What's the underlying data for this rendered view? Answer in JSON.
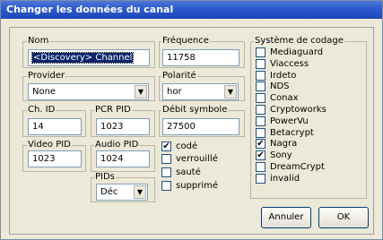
{
  "window": {
    "title": "Changer les données du canal"
  },
  "fields": {
    "nom": {
      "label": "Nom",
      "value": "<Discovery> Channel"
    },
    "frequence": {
      "label": "Fréquence",
      "value": "11758"
    },
    "provider": {
      "label": "Provider",
      "value": "None"
    },
    "polarite": {
      "label": "Polarité",
      "value": "hor"
    },
    "ch_id": {
      "label": "Ch. ID",
      "value": "14"
    },
    "pcr_pid": {
      "label": "PCR PID",
      "value": "1023"
    },
    "debit": {
      "label": "Débit symbole",
      "value": "27500"
    },
    "video_pid": {
      "label": "Video PID",
      "value": "1023"
    },
    "audio_pid": {
      "label": "Audio PID",
      "value": "1024"
    },
    "pids": {
      "label": "PIDs",
      "value": "Déc"
    }
  },
  "flags": [
    {
      "label": "codé",
      "checked": true
    },
    {
      "label": "verrouillé",
      "checked": false
    },
    {
      "label": "sauté",
      "checked": false
    },
    {
      "label": "supprimé",
      "checked": false
    }
  ],
  "systeme": {
    "label": "Système de codage",
    "items": [
      {
        "label": "Mediaguard",
        "checked": false
      },
      {
        "label": "Viaccess",
        "checked": false
      },
      {
        "label": "Irdeto",
        "checked": false
      },
      {
        "label": "NDS",
        "checked": false
      },
      {
        "label": "Conax",
        "checked": false
      },
      {
        "label": "Cryptoworks",
        "checked": false
      },
      {
        "label": "PowerVu",
        "checked": false
      },
      {
        "label": "Betacrypt",
        "checked": false
      },
      {
        "label": "Nagra",
        "checked": true
      },
      {
        "label": "Sony",
        "checked": true
      },
      {
        "label": "DreamCrypt",
        "checked": false
      },
      {
        "label": "invalid",
        "checked": false
      }
    ]
  },
  "buttons": {
    "cancel": "Annuler",
    "ok": "OK"
  },
  "glyphs": {
    "check": "✔",
    "dropdown": "▼"
  }
}
